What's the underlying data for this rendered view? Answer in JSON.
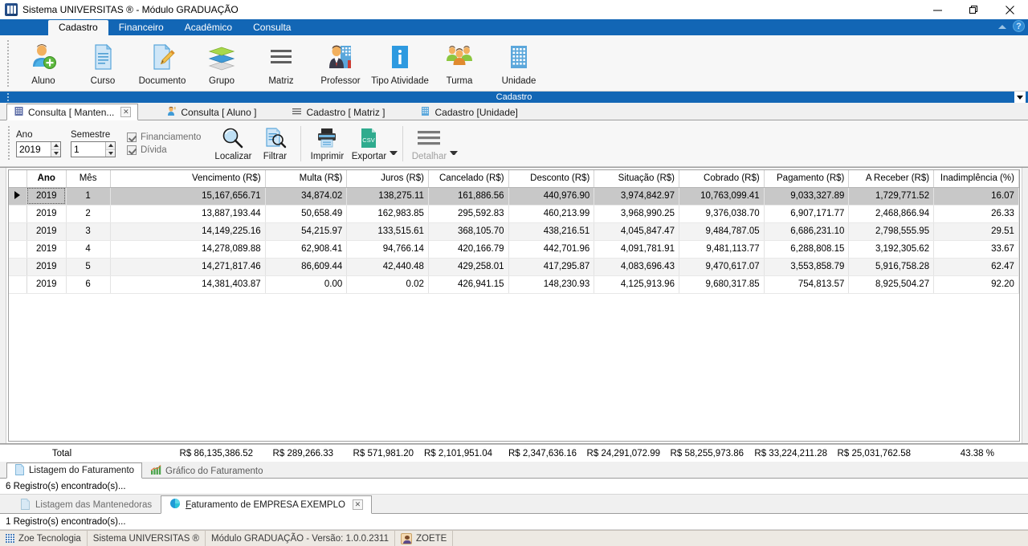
{
  "window": {
    "title": "Sistema UNIVERSITAS ® - Módulo GRADUAÇÃO",
    "app_icon": "app-book-icon",
    "minimize": "minimize-icon",
    "maximize": "restore-icon",
    "close": "close-icon"
  },
  "ribbon": {
    "tabs": [
      {
        "label": "Cadastro",
        "active": true
      },
      {
        "label": "Financeiro",
        "active": false
      },
      {
        "label": "Acadêmico",
        "active": false
      },
      {
        "label": "Consulta",
        "active": false
      }
    ],
    "collapse_icon": "chevron-up-icon",
    "help_icon": "help-question-icon",
    "group_caption": "Cadastro",
    "group_expand_icon": "dropdown-arrow-icon",
    "items": [
      {
        "label": "Aluno",
        "icon": "user-add-icon"
      },
      {
        "label": "Curso",
        "icon": "document-lines-icon"
      },
      {
        "label": "Documento",
        "icon": "document-edit-icon"
      },
      {
        "label": "Grupo",
        "icon": "layers-icon"
      },
      {
        "label": "Matriz",
        "icon": "list-lines-icon"
      },
      {
        "label": "Professor",
        "icon": "teacher-building-icon"
      },
      {
        "label": "Tipo Atividade",
        "icon": "info-icon"
      },
      {
        "label": "Turma",
        "icon": "group-people-icon"
      },
      {
        "label": "Unidade",
        "icon": "building-icon"
      }
    ]
  },
  "doc_tabs": [
    {
      "label": "Consulta [ Manten...",
      "icon": "building-small-icon",
      "active": true,
      "closable": true,
      "close_label": "✕"
    },
    {
      "label": "Consulta [ Aluno ]",
      "icon": "user-small-icon",
      "active": false,
      "closable": false
    },
    {
      "label": "Cadastro [ Matriz ]",
      "icon": "list-small-icon",
      "active": false,
      "closable": false
    },
    {
      "label": "Cadastro [Unidade]",
      "icon": "building-grid-icon",
      "active": false,
      "closable": false
    }
  ],
  "filterbar": {
    "ano_label": "Ano",
    "ano_value": "2019",
    "semestre_label": "Semestre",
    "semestre_value": "1",
    "checkboxes": [
      {
        "label": "Financiamento",
        "checked": true
      },
      {
        "label": "Dívida",
        "checked": true
      }
    ],
    "buttons": [
      {
        "label": "Localizar",
        "icon": "magnifier-icon",
        "disabled": false
      },
      {
        "label": "Filtrar",
        "icon": "filter-search-icon",
        "disabled": false
      },
      {
        "label": "Imprimir",
        "icon": "printer-icon",
        "disabled": false
      },
      {
        "label": "Exportar",
        "icon": "csv-export-icon",
        "disabled": false,
        "has_caret": true
      },
      {
        "label": "Detalhar",
        "icon": "detail-lines-icon",
        "disabled": true,
        "has_caret": true
      }
    ]
  },
  "grid": {
    "columns": [
      "Ano",
      "Mês",
      "Vencimento (R$)",
      "Multa (R$)",
      "Juros (R$)",
      "Cancelado (R$)",
      "Desconto (R$)",
      "Situação (R$)",
      "Cobrado (R$)",
      "Pagamento (R$)",
      "A Receber (R$)",
      "Inadimplência (%)"
    ],
    "rows": [
      {
        "selected": true,
        "cells": [
          "2019",
          "1",
          "15,167,656.71",
          "34,874.02",
          "138,275.11",
          "161,886.56",
          "440,976.90",
          "3,974,842.97",
          "10,763,099.41",
          "9,033,327.89",
          "1,729,771.52",
          "16.07"
        ]
      },
      {
        "selected": false,
        "cells": [
          "2019",
          "2",
          "13,887,193.44",
          "50,658.49",
          "162,983.85",
          "295,592.83",
          "460,213.99",
          "3,968,990.25",
          "9,376,038.70",
          "6,907,171.77",
          "2,468,866.94",
          "26.33"
        ]
      },
      {
        "selected": false,
        "cells": [
          "2019",
          "3",
          "14,149,225.16",
          "54,215.97",
          "133,515.61",
          "368,105.70",
          "438,216.51",
          "4,045,847.47",
          "9,484,787.05",
          "6,686,231.10",
          "2,798,555.95",
          "29.51"
        ]
      },
      {
        "selected": false,
        "cells": [
          "2019",
          "4",
          "14,278,089.88",
          "62,908.41",
          "94,766.14",
          "420,166.79",
          "442,701.96",
          "4,091,781.91",
          "9,481,113.77",
          "6,288,808.15",
          "3,192,305.62",
          "33.67"
        ]
      },
      {
        "selected": false,
        "cells": [
          "2019",
          "5",
          "14,271,817.46",
          "86,609.44",
          "42,440.48",
          "429,258.01",
          "417,295.87",
          "4,083,696.43",
          "9,470,617.07",
          "3,553,858.79",
          "5,916,758.28",
          "62.47"
        ]
      },
      {
        "selected": false,
        "cells": [
          "2019",
          "6",
          "14,381,403.87",
          "0.00",
          "0.02",
          "426,941.15",
          "148,230.93",
          "4,125,913.96",
          "9,680,317.85",
          "754,813.57",
          "8,925,504.27",
          "92.20"
        ]
      }
    ],
    "total": {
      "label": "Total",
      "values": [
        "R$ 86,135,386.52",
        "R$ 289,266.33",
        "R$ 571,981.20",
        "R$ 2,101,951.04",
        "R$ 2,347,636.16",
        "R$ 24,291,072.99",
        "R$ 58,255,973.86",
        "R$ 33,224,211.28",
        "R$ 25,031,762.58",
        "43.38 %"
      ]
    }
  },
  "lower_tabs": [
    {
      "label": "Listagem do Faturamento",
      "icon": "document-blue-icon",
      "active": true
    },
    {
      "label": "Gráfico do Faturamento",
      "icon": "chart-bars-icon",
      "active": false
    }
  ],
  "status_upper": "6 Registro(s) encontrado(s)...",
  "lower_tabs2": [
    {
      "label": "Listagem das Mantenedoras",
      "icon": "document-blue-icon",
      "active": false,
      "closable": false
    },
    {
      "label_pre": "F",
      "label": "aturamento de EMPRESA EXEMPLO",
      "icon": "pie-chart-icon",
      "active": true,
      "closable": true,
      "close_label": "✕"
    }
  ],
  "status_lower": "1 Registro(s) encontrado(s)...",
  "appstatus": {
    "grid_icon": "grid-blue-icon",
    "company": "Zoe Tecnologia",
    "system": "Sistema UNIVERSITAS ®",
    "module": "Módulo GRADUAÇÃO - Versão: 1.0.0.2311",
    "user_icon": "user-avatar-icon",
    "user": "ZOETE"
  },
  "colors": {
    "ribbon_blue": "#1266b5",
    "accent": "#2e8ad6",
    "selection_gray": "#c8c8c8",
    "status_bg": "#ede9e3"
  }
}
